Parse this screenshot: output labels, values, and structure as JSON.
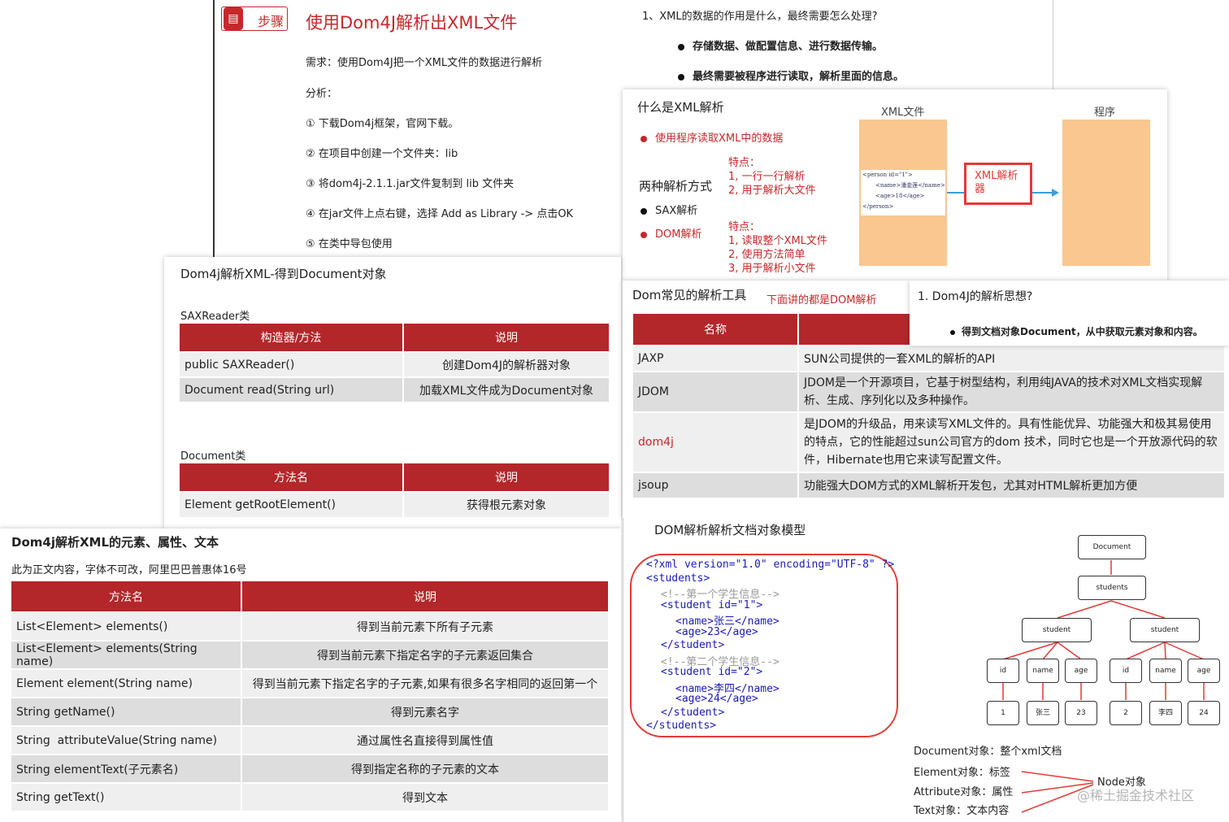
{
  "panel_steps": {
    "badge": "步骤",
    "title": "使用Dom4J解析出XML文件",
    "need": "需求：使用Dom4J把一个XML文件的数据进行解析",
    "analysis": "分析：",
    "steps": [
      "① 下载Dom4j框架，官网下载。",
      "② 在项目中创建一个文件夹：lib",
      "③ 将dom4j-2.1.1.jar文件复制到 lib 文件夹",
      "④ 在jar文件上点右键，选择 Add as Library -> 点击OK",
      "⑤ 在类中导包使用"
    ]
  },
  "panel_purpose": {
    "question": "1、XML的数据的作用是什么，最终需要怎么处理?",
    "bullets": [
      "存储数据、做配置信息、进行数据传输。",
      "最终需要被程序进行读取，解析里面的信息。"
    ]
  },
  "panel_what": {
    "title": "什么是XML解析",
    "bullet": "使用程序读取XML中的数据",
    "two_ways": "两种解析方式",
    "sax": "SAX解析",
    "dom": "DOM解析",
    "sax_features": [
      "特点：",
      "1, 一行一行解析",
      "2, 用于解析大文件"
    ],
    "dom_features": [
      "特点：",
      "1, 读取整个XML文件",
      "2, 使用方法简单",
      "3, 用于解析小文件"
    ],
    "xml_file_label": "XML文件",
    "program_label": "程序",
    "parser_label": "XML解析器",
    "xml_snippet": [
      "<person id=\"1\">",
      "<name>潘金莲</name>",
      "<age>18</age>",
      "</person>"
    ]
  },
  "panel_saxreader": {
    "title": "Dom4j解析XML-得到Document对象",
    "class1": "SAXReader类",
    "headers1": [
      "构造器/方法",
      "说明"
    ],
    "rows1": [
      [
        "public SAXReader()",
        "创建Dom4J的解析器对象"
      ],
      [
        "Document read(String url)",
        "加载XML文件成为Document对象"
      ]
    ],
    "class2": "Document类",
    "headers2": [
      "方法名",
      "说明"
    ],
    "rows2": [
      [
        "Element getRootElement()",
        "获得根元素对象"
      ]
    ]
  },
  "panel_tools": {
    "title": "Dom常见的解析工具",
    "note": "下面讲的都是DOM解析",
    "headers": [
      "名称",
      ""
    ],
    "rows": [
      [
        "JAXP",
        "SUN公司提供的一套XML的解析的API"
      ],
      [
        "JDOM",
        "JDOM是一个开源项目，它基于树型结构，利用纯JAVA的技术对XML文档实现解析、生成、序列化以及多种操作。"
      ],
      [
        "dom4j",
        "是JDOM的升级品，用来读写XML文件的。具有性能优异、功能强大和极其易使用的特点，它的性能超过sun公司官方的dom 技术，同时它也是一个开放源代码的软件，Hibernate也用它来读写配置文件。"
      ],
      [
        "jsoup",
        "功能强大DOM方式的XML解析开发包，尤其对HTML解析更加方便"
      ]
    ]
  },
  "panel_idea": {
    "question": "1.   Dom4J的解析思想?",
    "bullet": "得到文档对象Document，从中获取元素对象和内容。"
  },
  "panel_elements": {
    "title": "Dom4j解析XML的元素、属性、文本",
    "subtitle": "此为正文内容，字体不可改，阿里巴巴普惠体16号",
    "headers": [
      "方法名",
      "说明"
    ],
    "rows": [
      [
        "List<Element> elements()",
        "得到当前元素下所有子元素"
      ],
      [
        "List<Element> elements(String name)",
        "得到当前元素下指定名字的子元素返回集合"
      ],
      [
        "Element element(String name)",
        "得到当前元素下指定名字的子元素,如果有很多名字相同的返回第一个"
      ],
      [
        "String getName()",
        "得到元素名字"
      ],
      [
        "String  attributeValue(String name)",
        "通过属性名直接得到属性值"
      ],
      [
        "String elementText(子元素名)",
        "得到指定名称的子元素的文本"
      ],
      [
        "String getText()",
        "得到文本"
      ]
    ]
  },
  "panel_dommodel": {
    "title": "DOM解析解析文档对象模型",
    "xml_lines": [
      "<?xml version=\"1.0\" encoding=\"UTF-8\" ?>",
      "<students>",
      "<!--第一个学生信息-->",
      "<student id=\"1\">",
      "<name>张三</name>",
      "<age>23</age>",
      "</student>",
      "<!--第二个学生信息-->",
      "<student id=\"2\">",
      "<name>李四</name>",
      "<age>24</age>",
      "</student>",
      "</students>"
    ],
    "tree": {
      "root": "Document",
      "level1": "students",
      "level2": [
        "student",
        "student"
      ],
      "level3": [
        "id",
        "name",
        "age",
        "id",
        "name",
        "age"
      ],
      "level4": [
        "1",
        "张三",
        "23",
        "2",
        "李四",
        "24"
      ]
    },
    "legend": [
      "Document对象：整个xml文档",
      "Element对象：标签",
      "Attribute对象：属性",
      "Text对象：文本内容"
    ],
    "node_label": "Node对象",
    "watermark": "@稀土掘金技术社区"
  },
  "colors": {
    "accent": "#b3272a",
    "parser_box": "#e53935",
    "orange_block": "#f9c78f"
  }
}
